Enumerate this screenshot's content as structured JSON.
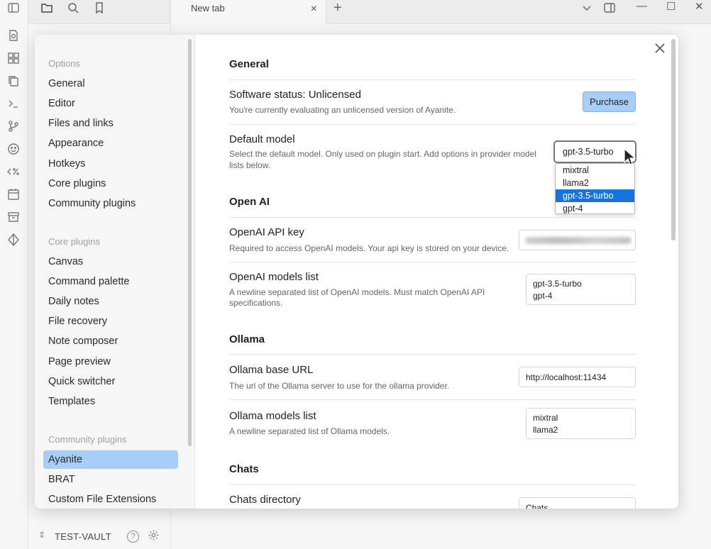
{
  "app": {
    "tab_title": "New tab",
    "tab_close": "×",
    "new_tab": "+",
    "header_title": "New tab",
    "vault_name": "TEST-VAULT",
    "help_glyph": "?"
  },
  "nav": {
    "options_heading": "Options",
    "options": [
      "General",
      "Editor",
      "Files and links",
      "Appearance",
      "Hotkeys",
      "Core plugins",
      "Community plugins"
    ],
    "core_heading": "Core plugins",
    "core": [
      "Canvas",
      "Command palette",
      "Daily notes",
      "File recovery",
      "Note composer",
      "Page preview",
      "Quick switcher",
      "Templates"
    ],
    "community_heading": "Community plugins",
    "community": [
      "Ayanite",
      "BRAT",
      "Custom File Extensions"
    ]
  },
  "settings": {
    "general_heading": "General",
    "software_status_name": "Software status: Unlicensed",
    "software_status_desc": "You're currently evaluating an unlicensed version of Ayanite.",
    "purchase_label": "Purchase",
    "default_model_name": "Default model",
    "default_model_desc_1": "Select the default model. Only used on plugin start. Add options in provider model",
    "default_model_desc_2": "lists below.",
    "default_model_value": "gpt-3.5-turbo",
    "model_options": [
      "mixtral",
      "llama2",
      "gpt-3.5-turbo",
      "gpt-4"
    ],
    "selected_option_index": 2,
    "openai_heading": "Open AI",
    "openai_key_name": "OpenAI API key",
    "openai_key_desc": "Required to access OpenAI models. Your api key is stored on your device.",
    "openai_models_name": "OpenAI models list",
    "openai_models_desc_1": "A newline separated list of OpenAI models. Must match OpenAI API",
    "openai_models_desc_2": "specifications.",
    "openai_models_value": "gpt-3.5-turbo\ngpt-4",
    "ollama_heading": "Ollama",
    "ollama_url_name": "Ollama base URL",
    "ollama_url_desc": "The url of the Ollama server to use for the ollama provider.",
    "ollama_url_value": "http://localhost:11434",
    "ollama_models_name": "Ollama models list",
    "ollama_models_desc": "A newline separated list of Ollama models.",
    "ollama_models_value": "mixtral\nllama2",
    "chats_heading": "Chats",
    "chats_dir_name": "Chats directory",
    "chats_dir_value": "Chats"
  }
}
